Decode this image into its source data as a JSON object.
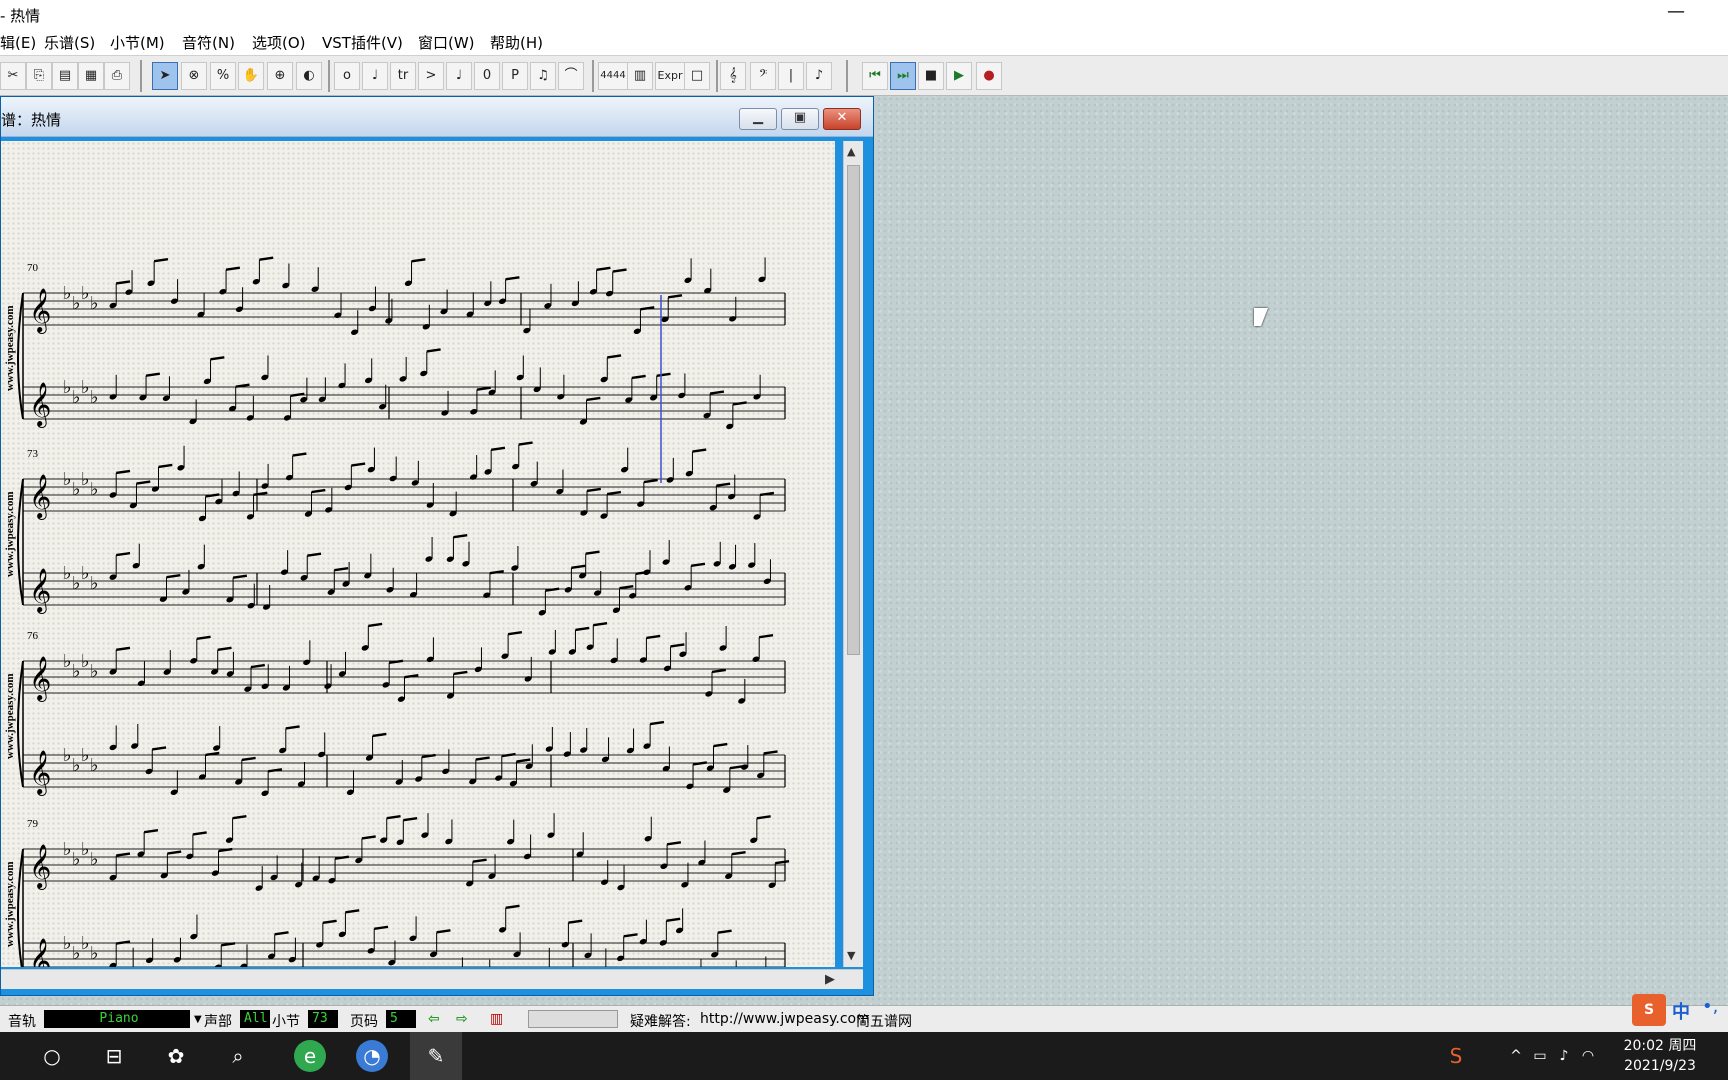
{
  "app": {
    "title": "- 热情"
  },
  "menubar": {
    "items": [
      "辑(E)",
      "乐谱(S)",
      "小节(M)",
      "音符(N)",
      "选项(O)",
      "VST插件(V)",
      "窗口(W)",
      "帮助(H)"
    ]
  },
  "toolbar": {
    "buttons": [
      "cut-icon",
      "copy-icon",
      "paste-icon",
      "print-icon",
      "select-arrow-icon",
      "erase-icon",
      "percent-icon",
      "hand-icon",
      "zoom-icon",
      "speaker-icon",
      "whole-note-icon",
      "note-icon",
      "trill-icon",
      "accent-icon",
      "quarter-note-icon",
      "zero-icon",
      "p-icon",
      "eighth-note-icon",
      "slur-icon",
      "4444-icon",
      "grid-icon",
      "expr-icon",
      "box-icon",
      "treble-clef-icon",
      "clef-icon",
      "bar-icon",
      "voice-icon"
    ],
    "labels": {
      "trill": "tr",
      "accent": ">",
      "zero": "0",
      "p": "P",
      "num": "4444",
      "expr": "Expr"
    },
    "transport": [
      "rewind-icon",
      "play-from-icon",
      "stop-icon",
      "play-icon",
      "record-icon"
    ]
  },
  "score_window": {
    "title": "谱：热情",
    "measure_numbers": [
      "70",
      "73",
      "76",
      "79"
    ],
    "watermark": "www.jwpeasy.com"
  },
  "statusbar": {
    "track_label": "音轨",
    "track_value": "Piano",
    "voice_label": "声部",
    "voice_value": "All",
    "measure_label": "小节",
    "measure_value": "73",
    "page_label": "页码",
    "page_value": "5",
    "help_text": "疑难解答:",
    "url": "http://www.jwpeasy.com",
    "site": "简五谱网"
  },
  "taskbar": {
    "apps": [
      "search-icon",
      "task-view-icon",
      "app-icon",
      "browser-icon",
      "chrome-icon",
      "browser2-icon",
      "score-app-icon"
    ]
  },
  "tray": {
    "time": "20:02 周四",
    "date": "2021/9/23"
  },
  "ime": {
    "label": "中"
  }
}
